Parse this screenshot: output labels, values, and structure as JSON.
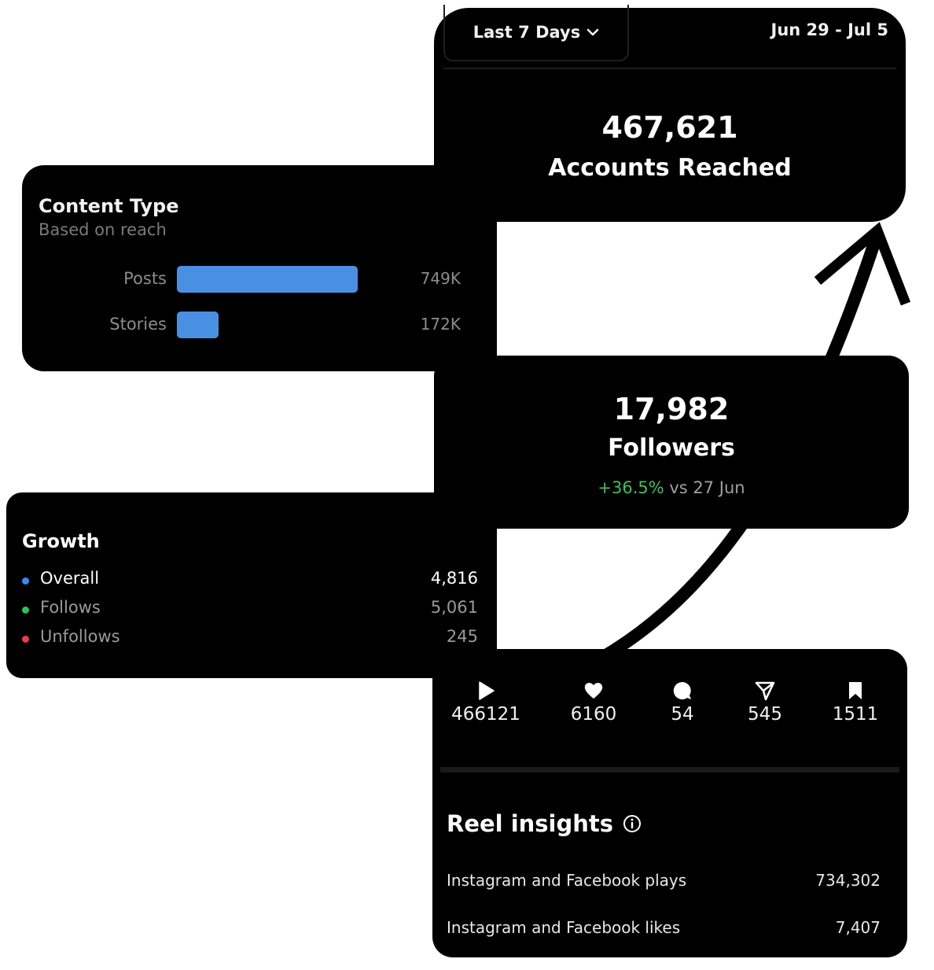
{
  "reach": {
    "range_label": "Last 7 Days",
    "date_range": "Jun 29 - Jul 5",
    "value": "467,621",
    "label": "Accounts Reached"
  },
  "content_type": {
    "title": "Content Type",
    "subtitle": "Based on reach",
    "rows": [
      {
        "label": "Posts",
        "value_text": "749K",
        "value": 749
      },
      {
        "label": "Stories",
        "value_text": "172K",
        "value": 172
      }
    ],
    "bar_color": "#4a90e2"
  },
  "followers": {
    "value": "17,982",
    "label": "Followers",
    "change_pct": "+36.5%",
    "change_ref": " vs 27 Jun",
    "change_color": "#3ec15a"
  },
  "growth": {
    "title": "Growth",
    "rows": [
      {
        "label": "Overall",
        "value": "4,816",
        "dot_color": "#2e8ef5",
        "text_color": "#ffffff"
      },
      {
        "label": "Follows",
        "value": "5,061",
        "dot_color": "#2ec34f",
        "text_color": "#9a9a9a"
      },
      {
        "label": "Unfollows",
        "value": "245",
        "dot_color": "#f0384b",
        "text_color": "#9a9a9a"
      }
    ]
  },
  "reel": {
    "stats": [
      {
        "icon": "play-icon",
        "value": "466121"
      },
      {
        "icon": "heart-icon",
        "value": "6160"
      },
      {
        "icon": "comment-icon",
        "value": "54"
      },
      {
        "icon": "share-icon",
        "value": "545"
      },
      {
        "icon": "bookmark-icon",
        "value": "1511"
      }
    ],
    "insights_title": "Reel insights",
    "insights": [
      {
        "label": "Instagram and Facebook plays",
        "value": "734,302"
      },
      {
        "label": "Instagram and Facebook likes",
        "value": "7,407"
      }
    ]
  }
}
